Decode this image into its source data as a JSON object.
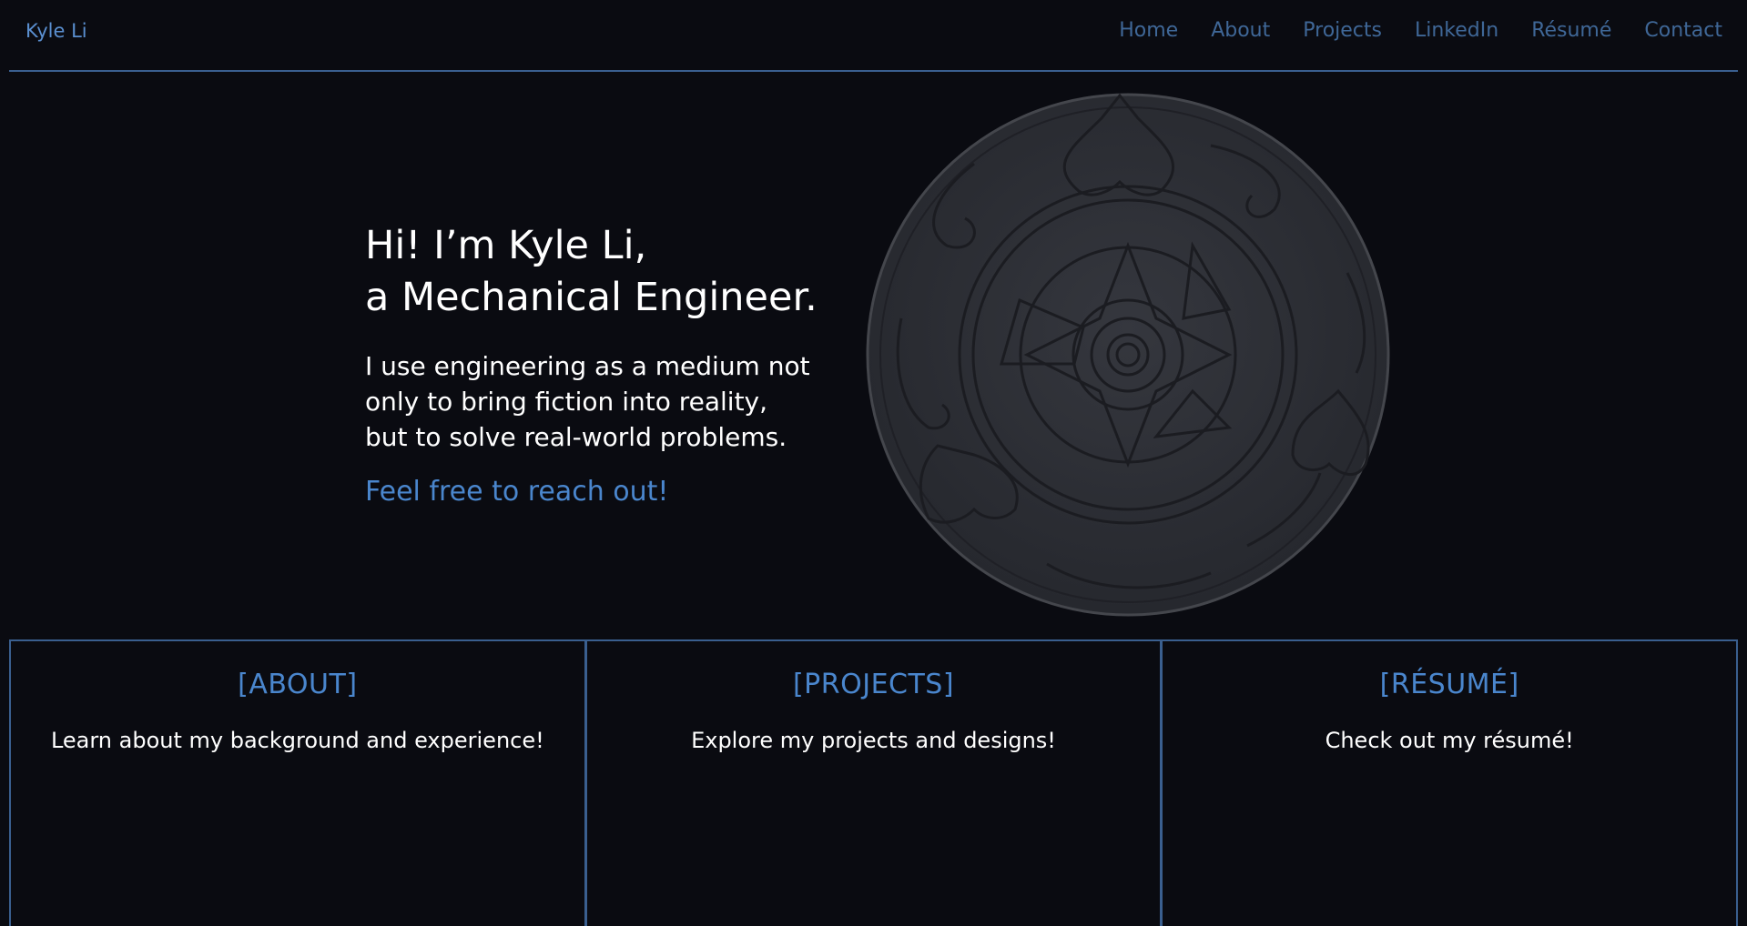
{
  "header": {
    "brand": "Kyle Li",
    "nav": [
      "Home",
      "About",
      "Projects",
      "LinkedIn",
      "Résumé",
      "Contact"
    ]
  },
  "hero": {
    "headline_line1": "Hi! I’m Kyle Li,",
    "headline_line2": "a Mechanical Engineer.",
    "tagline_line1": "I use engineering as a medium not",
    "tagline_line2": "only to bring fiction into reality,",
    "tagline_line3": "but to solve real-world problems.",
    "cta": "Feel free to reach out!"
  },
  "cards": [
    {
      "title": "[ABOUT]",
      "desc": "Learn about my background and experience!"
    },
    {
      "title": "[PROJECTS]",
      "desc": "Explore my projects and designs!"
    },
    {
      "title": "[RÉSUMÉ]",
      "desc": "Check out my résumé!"
    }
  ],
  "colors": {
    "background": "#0a0b11",
    "accent": "#4a86cd",
    "nav": "#3f6797",
    "border": "#3a5f8f",
    "emblem": "#2a2c33"
  }
}
